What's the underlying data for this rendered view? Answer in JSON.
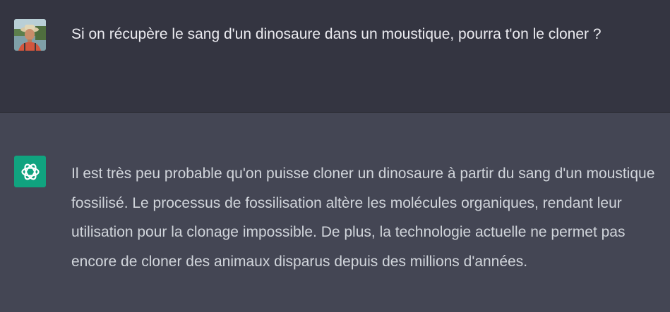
{
  "conversation": {
    "user_message": {
      "avatar": "user-photo-avatar",
      "text": "Si on récupère le sang d'un dinosaure dans un moustique, pourra t'on le cloner ?"
    },
    "assistant_message": {
      "avatar": "openai-logo-icon",
      "text": "Il est très peu probable qu'on puisse cloner un dinosaure à partir du sang d'un moustique fossilisé. Le processus de fossilisation altère les molécules organiques, rendant leur utilisation pour la clonage impossible. De plus, la technologie actuelle ne permet pas encore de cloner des animaux disparus depuis des millions d'années."
    }
  },
  "colors": {
    "user_bg": "#343541",
    "assistant_bg": "#444654",
    "bot_avatar_bg": "#10a37f",
    "user_text": "#ececf1",
    "assistant_text": "#d1d5db"
  }
}
